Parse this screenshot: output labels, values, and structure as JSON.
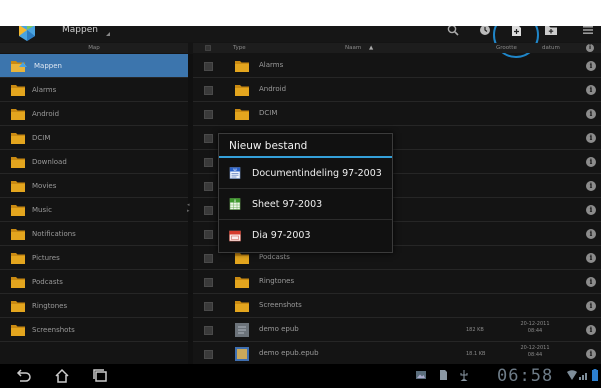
{
  "app": {
    "title": "Mappen"
  },
  "columns": {
    "left_header": "Map",
    "type": "Type",
    "name": "Naam",
    "size": "Grootte",
    "date": "datum"
  },
  "sidebar": {
    "items": [
      {
        "label": "Mappen",
        "active": true
      },
      {
        "label": "Alarms"
      },
      {
        "label": "Android"
      },
      {
        "label": "DCIM"
      },
      {
        "label": "Download"
      },
      {
        "label": "Movies"
      },
      {
        "label": "Music"
      },
      {
        "label": "Notifications"
      },
      {
        "label": "Pictures"
      },
      {
        "label": "Podcasts"
      },
      {
        "label": "Ringtones"
      },
      {
        "label": "Screenshots"
      }
    ]
  },
  "files": [
    {
      "name": "Alarms",
      "kind": "folder"
    },
    {
      "name": "Android",
      "kind": "folder"
    },
    {
      "name": "DCIM",
      "kind": "folder"
    },
    {
      "name": "",
      "kind": "folder"
    },
    {
      "name": "",
      "kind": "folder"
    },
    {
      "name": "",
      "kind": "folder"
    },
    {
      "name": "",
      "kind": "folder"
    },
    {
      "name": "",
      "kind": "folder"
    },
    {
      "name": "Podcasts",
      "kind": "folder"
    },
    {
      "name": "Ringtones",
      "kind": "folder"
    },
    {
      "name": "Screenshots",
      "kind": "folder"
    },
    {
      "name": "demo epub",
      "kind": "doc",
      "size": "182 KB",
      "date": "20-12-2011",
      "time": "08:44"
    },
    {
      "name": "demo epub.epub",
      "kind": "book",
      "size": "18.1 KB",
      "date": "20-12-2011",
      "time": "08:44"
    }
  ],
  "dialog": {
    "title": "Nieuw bestand",
    "items": [
      {
        "label": "Documentindeling 97-2003",
        "icon": "word-doc-icon",
        "color": "#2a62c9"
      },
      {
        "label": "Sheet 97-2003",
        "icon": "spreadsheet-icon",
        "color": "#3f9a2e"
      },
      {
        "label": "Dia 97-2003",
        "icon": "slides-icon",
        "color": "#d63c2c"
      }
    ]
  },
  "status": {
    "clock": "06:58"
  },
  "colors": {
    "accent": "#34a0d9",
    "selection": "#3c75ad",
    "highlight_ring": "#1f86c9",
    "folder": "#e3a51e"
  }
}
